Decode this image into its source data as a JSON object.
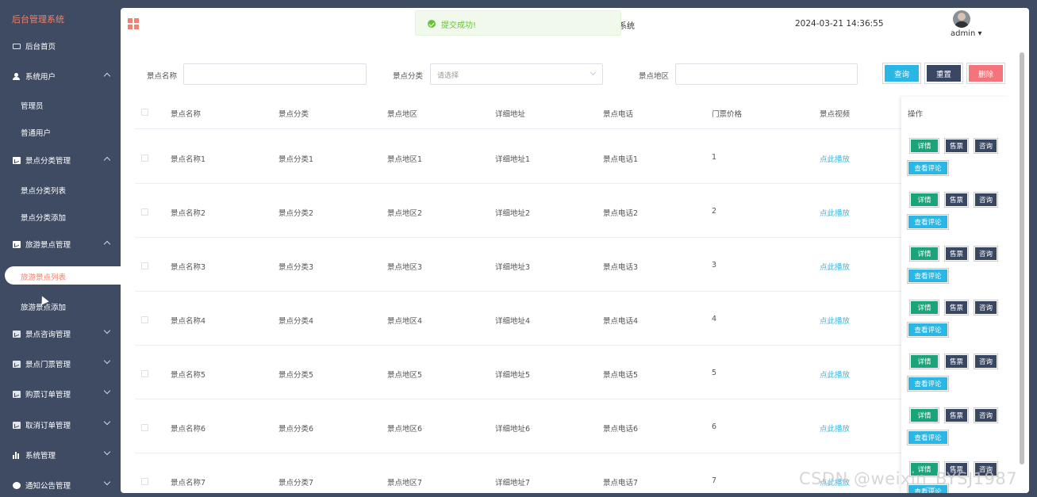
{
  "sidebar": {
    "brand": "后台管理系统",
    "items": [
      {
        "label": "后台首页"
      },
      {
        "label": "系统用户"
      },
      {
        "label": "管理员"
      },
      {
        "label": "普通用户"
      },
      {
        "label": "景点分类管理"
      },
      {
        "label": "景点分类列表"
      },
      {
        "label": "景点分类添加"
      },
      {
        "label": "旅游景点管理"
      },
      {
        "label": "旅游景点列表"
      },
      {
        "label": "旅游景点添加"
      },
      {
        "label": "景点咨询管理"
      },
      {
        "label": "景点门票管理"
      },
      {
        "label": "购票订单管理"
      },
      {
        "label": "取消订单管理"
      },
      {
        "label": "系统管理"
      },
      {
        "label": "通知公告管理"
      }
    ]
  },
  "header": {
    "title_partial": "系统",
    "datetime": "2024-03-21 14:36:55",
    "user": "admin"
  },
  "toast": {
    "message": "提交成功!"
  },
  "search": {
    "name_label": "景点名称",
    "name_value": "",
    "category_label": "景点分类",
    "category_placeholder": "请选择",
    "region_label": "景点地区",
    "region_value": "",
    "query_button": "查询",
    "reset_button": "重置",
    "delete_button": "删除"
  },
  "table": {
    "headers": [
      "景点名称",
      "景点分类",
      "景点地区",
      "详细地址",
      "景点电话",
      "门票价格",
      "景点视频",
      "操作"
    ],
    "rows": [
      {
        "name": "景点名称1",
        "category": "景点分类1",
        "region": "景点地区1",
        "address": "详细地址1",
        "phone": "景点电话1",
        "price": "1",
        "video": "点此播放"
      },
      {
        "name": "景点名称2",
        "category": "景点分类2",
        "region": "景点地区2",
        "address": "详细地址2",
        "phone": "景点电话2",
        "price": "2",
        "video": "点此播放"
      },
      {
        "name": "景点名称3",
        "category": "景点分类3",
        "region": "景点地区3",
        "address": "详细地址3",
        "phone": "景点电话3",
        "price": "3",
        "video": "点此播放"
      },
      {
        "name": "景点名称4",
        "category": "景点分类4",
        "region": "景点地区4",
        "address": "详细地址4",
        "phone": "景点电话4",
        "price": "4",
        "video": "点此播放"
      },
      {
        "name": "景点名称5",
        "category": "景点分类5",
        "region": "景点地区5",
        "address": "详细地址5",
        "phone": "景点电话5",
        "price": "5",
        "video": "点此播放"
      },
      {
        "name": "景点名称6",
        "category": "景点分类6",
        "region": "景点地区6",
        "address": "详细地址6",
        "phone": "景点电话6",
        "price": "6",
        "video": "点此播放"
      },
      {
        "name": "景点名称7",
        "category": "景点分类7",
        "region": "景点地区7",
        "address": "详细地址7",
        "phone": "景点电话7",
        "price": "7",
        "video": "点此播放"
      }
    ],
    "actions": {
      "detail": "详情",
      "ticket": "售票",
      "consult": "咨询",
      "reviews": "查看评论"
    }
  },
  "watermark": "CSDN @weixin_BYSJ1987",
  "colors": {
    "sidebar_bg": "#3f4b62",
    "accent": "#f0826e",
    "query": "#2ab7e6",
    "reset": "#3a4763",
    "delete": "#f3747a",
    "detail": "#19a47a",
    "success": "#67c23a"
  }
}
